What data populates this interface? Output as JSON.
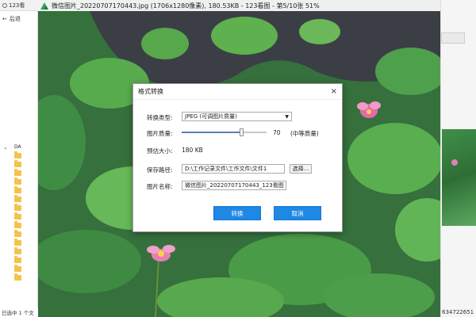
{
  "explorer": {
    "title": "123看",
    "back_label": "后退",
    "drive_label": "DA",
    "status": "已选中 1 个文"
  },
  "viewer": {
    "title": "微信图片_20220707170443.jpg (1706x1280像素), 180.53KB - 123看图 - 第5/10张 51%"
  },
  "right_panel": {
    "status": "634722651"
  },
  "dialog": {
    "title": "格式转换",
    "type_label": "转换类型:",
    "type_value": "JPEG (可调图片质量)",
    "quality_label": "图片质量:",
    "quality_value": "70",
    "quality_level": 0.7,
    "quality_desc": "(中等质量)",
    "size_label": "预估大小:",
    "size_value": "180 KB",
    "path_label": "保存路径:",
    "path_value": "D:\\工作记录文件\\工作文件\\文件1",
    "choose_label": "选择...",
    "name_label": "图片名称:",
    "name_value": "微信图片_20220707170443_123看图",
    "convert_label": "转换",
    "cancel_label": "取消"
  },
  "colors": {
    "primary": "#1e88e5",
    "water": "#3b3f45",
    "leaf": "#4fa04c",
    "lotus": "#e77db3"
  }
}
